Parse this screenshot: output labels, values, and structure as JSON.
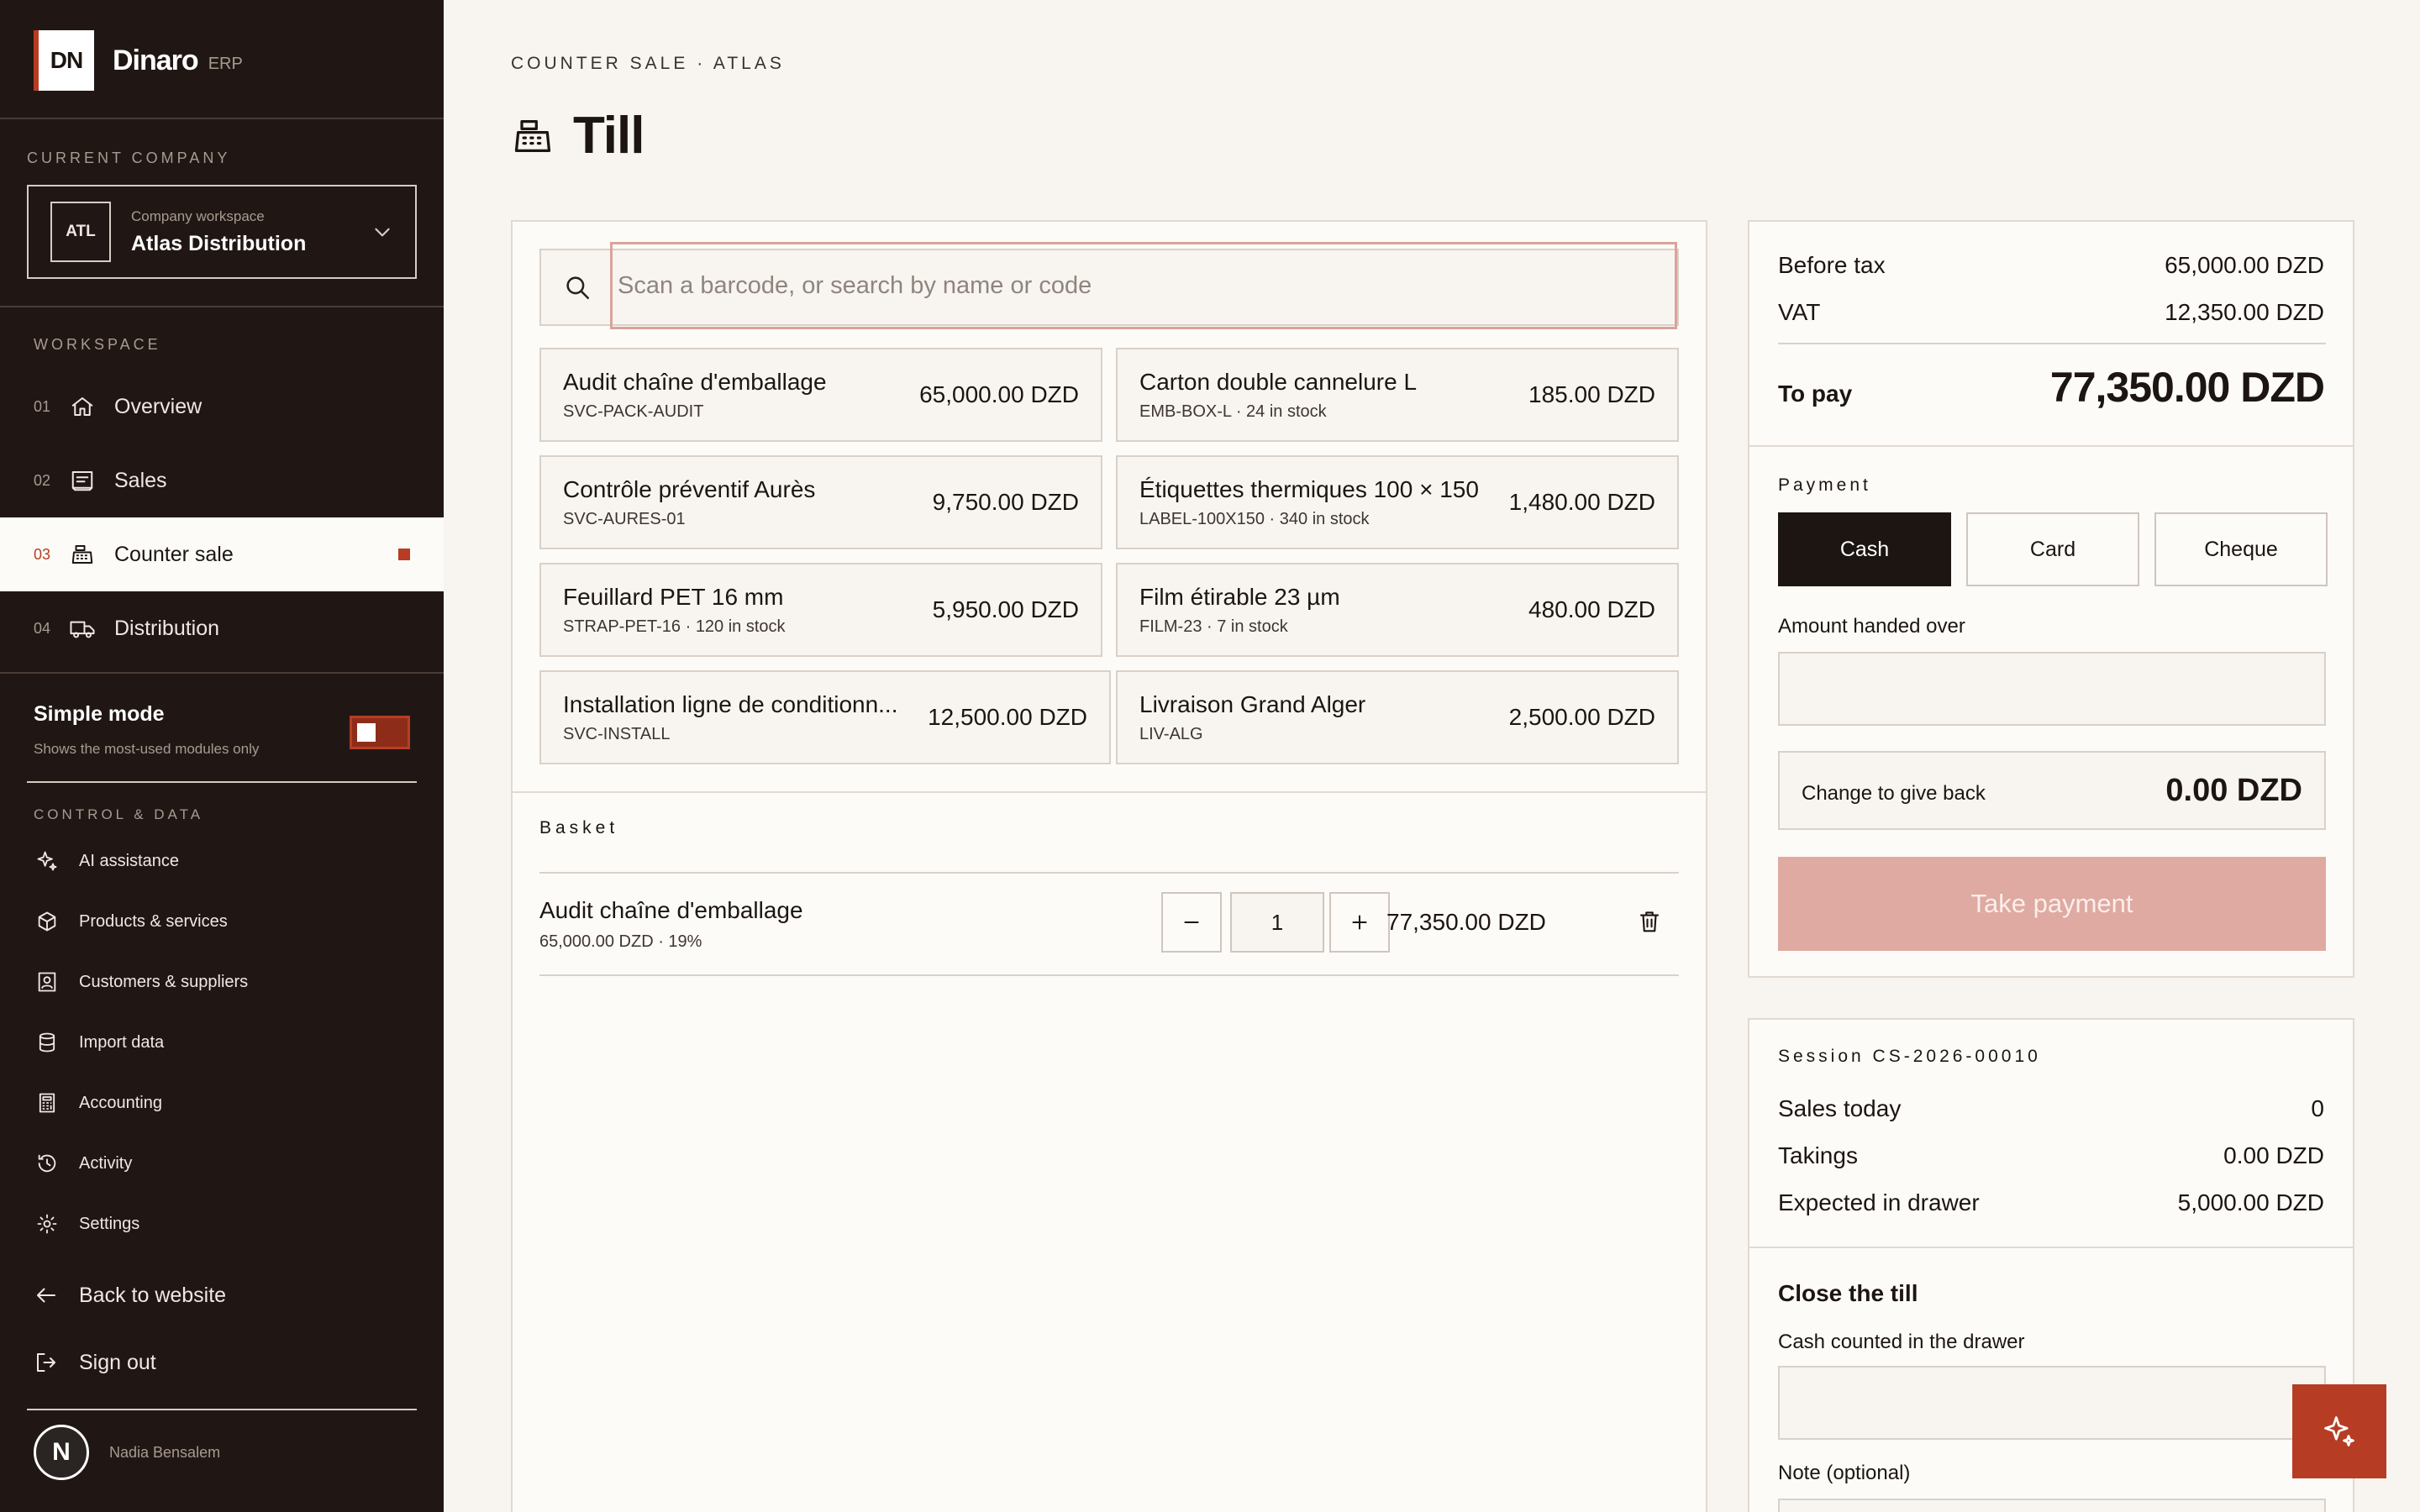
{
  "brand": {
    "logo": "DN",
    "name": "Dinaro",
    "suffix": "ERP"
  },
  "company": {
    "section_label": "CURRENT COMPANY",
    "badge": "ATL",
    "sub": "Company workspace",
    "name": "Atlas Distribution"
  },
  "workspace": {
    "label": "WORKSPACE",
    "items": [
      {
        "num": "01",
        "label": "Overview",
        "icon": "home-icon"
      },
      {
        "num": "02",
        "label": "Sales",
        "icon": "receipt-icon"
      },
      {
        "num": "03",
        "label": "Counter sale",
        "icon": "cash-register-icon",
        "active": true
      },
      {
        "num": "04",
        "label": "Distribution",
        "icon": "truck-icon"
      }
    ]
  },
  "simple_mode": {
    "title": "Simple mode",
    "subtitle": "Shows the most-used modules only",
    "enabled": true
  },
  "control": {
    "label": "CONTROL & DATA",
    "items": [
      {
        "label": "AI assistance",
        "icon": "sparkle-icon"
      },
      {
        "label": "Products & services",
        "icon": "box-icon"
      },
      {
        "label": "Customers & suppliers",
        "icon": "contacts-icon"
      },
      {
        "label": "Import data",
        "icon": "database-icon"
      },
      {
        "label": "Accounting",
        "icon": "calculator-icon"
      },
      {
        "label": "Activity",
        "icon": "history-icon"
      },
      {
        "label": "Settings",
        "icon": "gear-icon"
      }
    ]
  },
  "links": {
    "back": "Back to website",
    "signout": "Sign out"
  },
  "user": {
    "initial": "N",
    "name": "Nadia Bensalem"
  },
  "page": {
    "breadcrumb": "COUNTER SALE · ATLAS",
    "title": "Till"
  },
  "search": {
    "placeholder": "Scan a barcode, or search by name or code",
    "value": ""
  },
  "products": [
    {
      "name": "Audit chaîne d'emballage",
      "meta": "SVC-PACK-AUDIT",
      "price": "65,000.00 DZD"
    },
    {
      "name": "Carton double cannelure L",
      "meta": "EMB-BOX-L · 24 in stock",
      "price": "185.00 DZD"
    },
    {
      "name": "Contrôle préventif Aurès",
      "meta": "SVC-AURES-01",
      "price": "9,750.00 DZD"
    },
    {
      "name": "Étiquettes thermiques 100 × 150",
      "meta": "LABEL-100X150 · 340 in stock",
      "price": "1,480.00 DZD"
    },
    {
      "name": "Feuillard PET 16 mm",
      "meta": "STRAP-PET-16 · 120 in stock",
      "price": "5,950.00 DZD"
    },
    {
      "name": "Film étirable 23 µm",
      "meta": "FILM-23 · 7 in stock",
      "price": "480.00 DZD"
    },
    {
      "name": "Installation ligne de conditionn...",
      "meta": "SVC-INSTALL",
      "price": "12,500.00 DZD"
    },
    {
      "name": "Livraison Grand Alger",
      "meta": "LIV-ALG",
      "price": "2,500.00 DZD"
    }
  ],
  "basket": {
    "label": "Basket",
    "lines": [
      {
        "name": "Audit chaîne d'emballage",
        "meta": "65,000.00 DZD · 19%",
        "qty": "1",
        "total": "77,350.00 DZD"
      }
    ]
  },
  "totals": {
    "before_tax_label": "Before tax",
    "before_tax": "65,000.00 DZD",
    "vat_label": "VAT",
    "vat": "12,350.00 DZD",
    "to_pay_label": "To pay",
    "to_pay": "77,350.00 DZD"
  },
  "payment": {
    "label": "Payment",
    "methods": [
      "Cash",
      "Card",
      "Cheque"
    ],
    "selected": "Cash",
    "amount_label": "Amount handed over",
    "amount_value": "",
    "change_label": "Change to give back",
    "change_value": "0.00 DZD",
    "take_label": "Take payment"
  },
  "session": {
    "label": "Session CS-2026-00010",
    "sales_today_label": "Sales today",
    "sales_today": "0",
    "takings_label": "Takings",
    "takings": "0.00 DZD",
    "expected_label": "Expected in drawer",
    "expected": "5,000.00 DZD"
  },
  "close_till": {
    "title": "Close the till",
    "cash_label": "Cash counted in the drawer",
    "cash_value": "",
    "note_label": "Note (optional)"
  },
  "colors": {
    "sidebar": "#201714",
    "accent": "#b63d24",
    "background": "#f8f5f0",
    "button_disabled": "#deaaa1"
  }
}
